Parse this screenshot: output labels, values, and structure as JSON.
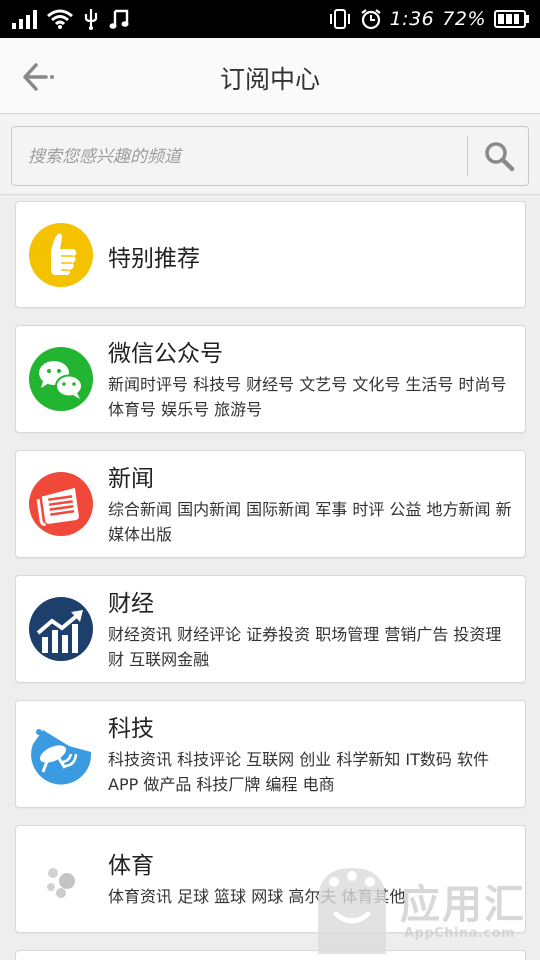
{
  "status_bar": {
    "time": "1:36",
    "battery": "72%",
    "icons": [
      "signal-icon",
      "wifi-icon",
      "usb-icon",
      "music-icon",
      "vibrate-icon",
      "alarm-icon",
      "battery-icon"
    ]
  },
  "header": {
    "title": "订阅中心",
    "back_icon": "back-arrow-icon"
  },
  "search": {
    "placeholder": "搜索您感兴趣的频道",
    "icon": "search-icon"
  },
  "categories": [
    {
      "name": "特别推荐",
      "tags": "",
      "icon": "thumbs-up-icon",
      "color": "#f5c200"
    },
    {
      "name": "微信公众号",
      "tags": "新闻时评号 科技号 财经号 文艺号 文化号 生活号 时尚号 体育号 娱乐号 旅游号",
      "icon": "wechat-icon",
      "color": "#22b532"
    },
    {
      "name": "新闻",
      "tags": "综合新闻 国内新闻 国际新闻 军事 时评 公益 地方新闻 新媒体出版",
      "icon": "newspaper-icon",
      "color": "#f0493a"
    },
    {
      "name": "财经",
      "tags": "财经资讯 财经评论 证券投资 职场管理 营销广告 投资理财 互联网金融",
      "icon": "finance-chart-icon",
      "color": "#1c3f6c"
    },
    {
      "name": "科技",
      "tags": "科技资讯 科技评论 互联网 创业 科学新知 IT数码 软件APP 做产品 科技厂牌 编程 电商",
      "icon": "satellite-icon",
      "color": "#3a9be0"
    },
    {
      "name": "体育",
      "tags": "体育资讯 足球 篮球 网球 高尔夫 体育其他",
      "icon": "balls-icon",
      "color": "#bbbbbb"
    }
  ],
  "watermark": {
    "text": "应用汇",
    "sub": "AppChina.com"
  }
}
